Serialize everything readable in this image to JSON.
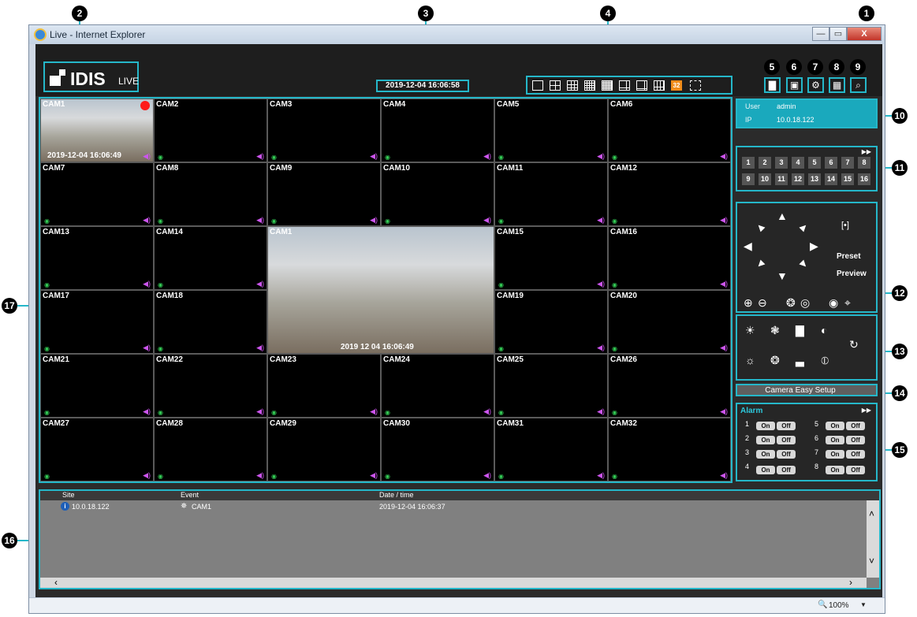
{
  "window": {
    "title": "Live - Internet Explorer",
    "min_label": "—",
    "max_label": "▭",
    "close_label": "X"
  },
  "header": {
    "logo_main": "IDIS",
    "logo_sub": "LIVE",
    "datetime": "2019-12-04 16:06:58",
    "layout_selected_label": "32"
  },
  "callouts": [
    "1",
    "2",
    "3",
    "4",
    "5",
    "6",
    "7",
    "8",
    "9",
    "10",
    "11",
    "12",
    "13",
    "14",
    "15",
    "16",
    "17"
  ],
  "grid": {
    "cells": [
      "CAM1",
      "CAM2",
      "CAM3",
      "CAM4",
      "CAM5",
      "CAM6",
      "CAM7",
      "CAM8",
      "CAM9",
      "CAM10",
      "CAM11",
      "CAM12",
      "CAM13",
      "CAM14",
      "CAM15",
      "CAM16",
      "CAM17",
      "CAM18",
      "CAM19",
      "CAM20",
      "CAM21",
      "CAM22",
      "CAM23",
      "CAM24",
      "CAM25",
      "CAM26",
      "CAM27",
      "CAM28",
      "CAM29",
      "CAM30",
      "CAM31",
      "CAM32"
    ],
    "big_cell_label": "CAM1",
    "cam1_timestamp": "2019-12-04 16:06:49",
    "big_timestamp": "2019 12 04 16:06:49"
  },
  "user_panel": {
    "user_label": "User",
    "user_value": "admin",
    "ip_label": "IP",
    "ip_value": "10.0.18.122"
  },
  "camera_numbers": [
    "1",
    "2",
    "3",
    "4",
    "5",
    "6",
    "7",
    "8",
    "9",
    "10",
    "11",
    "12",
    "13",
    "14",
    "15",
    "16"
  ],
  "ptz": {
    "preset_label": "Preset",
    "preview_label": "Preview"
  },
  "easy_setup_label": "Camera Easy Setup",
  "alarm": {
    "title": "Alarm",
    "on_label": "On",
    "off_label": "Off",
    "numbers": [
      "1",
      "2",
      "3",
      "4",
      "5",
      "6",
      "7",
      "8"
    ]
  },
  "events": {
    "col_site": "Site",
    "col_event": "Event",
    "col_datetime": "Date / time",
    "rows": [
      {
        "site": "10.0.18.122",
        "event": "CAM1",
        "datetime": "2019-12-04 16:06:37"
      }
    ]
  },
  "statusbar": {
    "zoom": "100%"
  },
  "colors": {
    "accent": "#25b7c9",
    "record": "#ff1a1a",
    "motion": "#33cc55",
    "audio": "#cc55ee"
  }
}
